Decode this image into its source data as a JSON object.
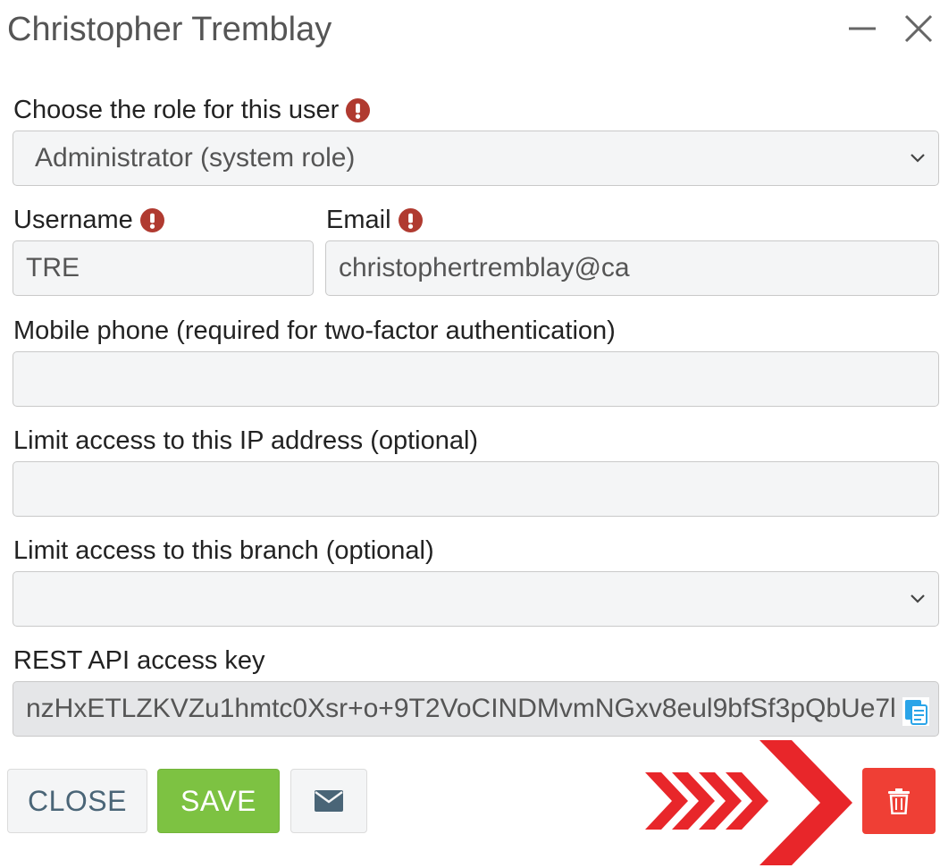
{
  "dialog": {
    "title": "Christopher Tremblay"
  },
  "form": {
    "role": {
      "label": "Choose the role for this user",
      "value": "Administrator (system role)",
      "required": true
    },
    "username": {
      "label": "Username",
      "value": "TRE",
      "required": true
    },
    "email": {
      "label": "Email",
      "value": "christophertremblay@ca",
      "required": true
    },
    "mobile": {
      "label": "Mobile phone (required for two-factor authentication)",
      "value": ""
    },
    "ip": {
      "label": "Limit access to this IP address (optional)",
      "value": ""
    },
    "branch": {
      "label": "Limit access to this branch (optional)",
      "value": ""
    },
    "api_key": {
      "label": "REST API access key",
      "value": "nzHxETLZKVZu1hmtc0Xsr+o+9T2VoCINDMvmNGxv8eul9bfSf3pQbUe7l"
    }
  },
  "buttons": {
    "close_label": "CLOSE",
    "save_label": "SAVE"
  },
  "icons": {
    "minimize": "minimize-icon",
    "close": "close-icon",
    "required": "exclamation-circle-icon",
    "chevron": "chevron-down-icon",
    "copy": "copy-icon",
    "mail": "envelope-icon",
    "delete": "trash-icon",
    "pointer": "chevron-arrows-annotation"
  },
  "colors": {
    "required": "#b03a30",
    "save": "#7dc242",
    "delete": "#ef3f35",
    "annotation": "#e8262a",
    "close_text": "#4a6577"
  }
}
